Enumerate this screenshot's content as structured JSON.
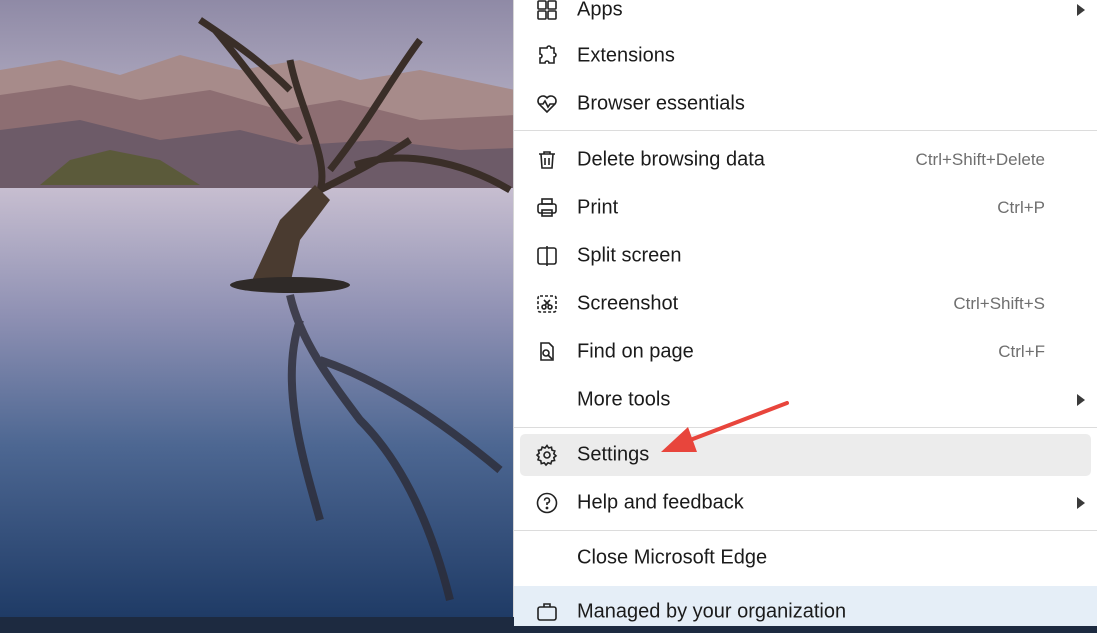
{
  "menu": {
    "items": [
      {
        "label": "Apps",
        "icon": "apps-icon",
        "submenu": true
      },
      {
        "label": "Extensions",
        "icon": "extensions-icon"
      },
      {
        "label": "Browser essentials",
        "icon": "heart-pulse-icon"
      },
      {
        "label": "Delete browsing data",
        "icon": "trash-icon",
        "shortcut": "Ctrl+Shift+Delete"
      },
      {
        "label": "Print",
        "icon": "printer-icon",
        "shortcut": "Ctrl+P"
      },
      {
        "label": "Split screen",
        "icon": "split-screen-icon"
      },
      {
        "label": "Screenshot",
        "icon": "screenshot-icon",
        "shortcut": "Ctrl+Shift+S"
      },
      {
        "label": "Find on page",
        "icon": "find-on-page-icon",
        "shortcut": "Ctrl+F"
      },
      {
        "label": "More tools",
        "submenu": true
      },
      {
        "label": "Settings",
        "icon": "gear-icon",
        "highlighted": true
      },
      {
        "label": "Help and feedback",
        "icon": "help-icon",
        "submenu": true
      },
      {
        "label": "Close Microsoft Edge"
      },
      {
        "label": "Managed by your organization",
        "icon": "briefcase-icon"
      }
    ]
  },
  "annotation": {
    "arrow_color": "#e8453c"
  },
  "colors": {
    "hover_bg": "#ececec",
    "managed_bg": "#e5eef7"
  }
}
